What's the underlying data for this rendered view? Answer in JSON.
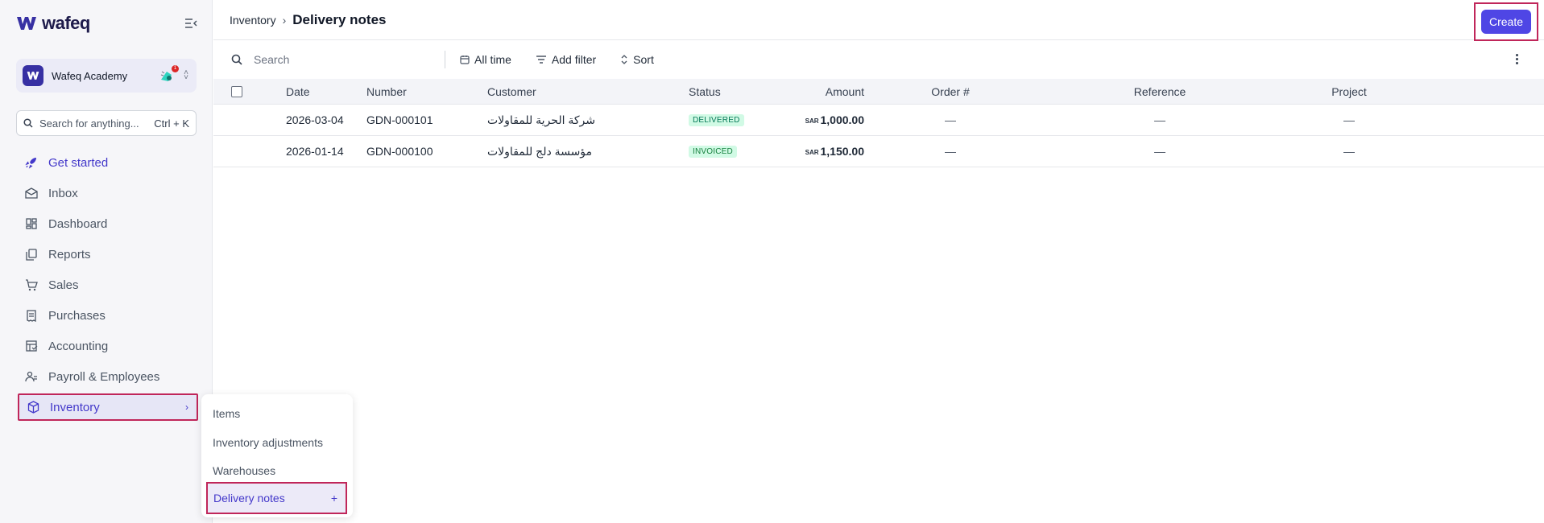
{
  "app": {
    "logo_text": "wafeq",
    "org_name": "Wafeq Academy",
    "org_badge": "1"
  },
  "sidebar": {
    "search_placeholder": "Search for anything...",
    "search_shortcut": "Ctrl + K",
    "items": [
      {
        "label": "Get started",
        "icon": "rocket-icon"
      },
      {
        "label": "Inbox",
        "icon": "inbox-icon"
      },
      {
        "label": "Dashboard",
        "icon": "dashboard-icon"
      },
      {
        "label": "Reports",
        "icon": "reports-icon"
      },
      {
        "label": "Sales",
        "icon": "cart-icon"
      },
      {
        "label": "Purchases",
        "icon": "receipt-icon"
      },
      {
        "label": "Accounting",
        "icon": "ledger-icon"
      },
      {
        "label": "Payroll & Employees",
        "icon": "employees-icon"
      },
      {
        "label": "Inventory",
        "icon": "box-icon"
      }
    ],
    "inventory_submenu": [
      {
        "label": "Items"
      },
      {
        "label": "Inventory adjustments"
      },
      {
        "label": "Warehouses"
      },
      {
        "label": "Delivery notes",
        "action": "+"
      }
    ]
  },
  "header": {
    "breadcrumb_parent": "Inventory",
    "breadcrumb_sep": "›",
    "title": "Delivery notes",
    "create_label": "Create"
  },
  "toolbar": {
    "search_placeholder": "Search",
    "all_time": "All time",
    "add_filter": "Add filter",
    "sort": "Sort"
  },
  "table": {
    "columns": [
      "Date",
      "Number",
      "Customer",
      "Status",
      "Amount",
      "Order #",
      "Reference",
      "Project"
    ],
    "rows": [
      {
        "date": "2026-03-04",
        "number": "GDN-000101",
        "customer": "شركة الحرية للمقاولات",
        "status": "DELIVERED",
        "currency": "SAR",
        "amount": "1,000.00",
        "order": "—",
        "reference": "—",
        "project": "—"
      },
      {
        "date": "2026-01-14",
        "number": "GDN-000100",
        "customer": "مؤسسة دلج للمقاولات",
        "status": "INVOICED",
        "currency": "SAR",
        "amount": "1,150.00",
        "order": "—",
        "reference": "—",
        "project": "—"
      }
    ]
  },
  "colors": {
    "accent": "#4f46e5",
    "highlight_border": "#c0265a",
    "status_green": "#047857"
  }
}
